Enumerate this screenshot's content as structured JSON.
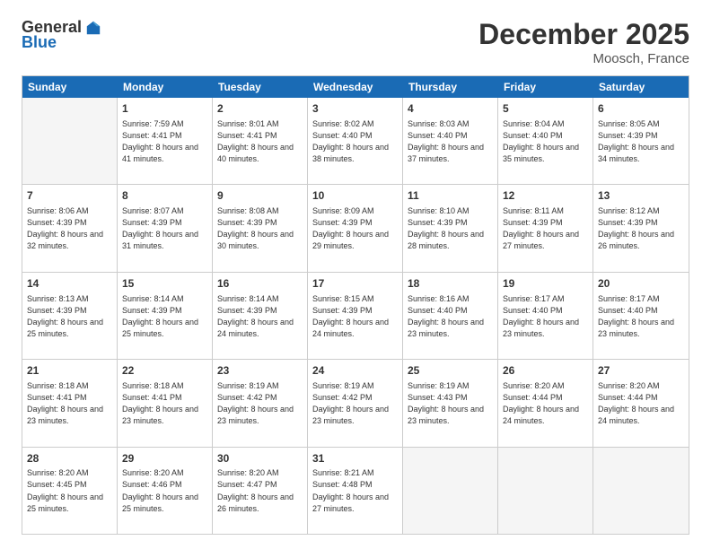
{
  "header": {
    "logo_general": "General",
    "logo_blue": "Blue",
    "month_title": "December 2025",
    "location": "Moosch, France"
  },
  "days_of_week": [
    "Sunday",
    "Monday",
    "Tuesday",
    "Wednesday",
    "Thursday",
    "Friday",
    "Saturday"
  ],
  "weeks": [
    [
      {
        "day": "",
        "empty": true
      },
      {
        "day": "1",
        "sunrise": "Sunrise: 7:59 AM",
        "sunset": "Sunset: 4:41 PM",
        "daylight": "Daylight: 8 hours and 41 minutes."
      },
      {
        "day": "2",
        "sunrise": "Sunrise: 8:01 AM",
        "sunset": "Sunset: 4:41 PM",
        "daylight": "Daylight: 8 hours and 40 minutes."
      },
      {
        "day": "3",
        "sunrise": "Sunrise: 8:02 AM",
        "sunset": "Sunset: 4:40 PM",
        "daylight": "Daylight: 8 hours and 38 minutes."
      },
      {
        "day": "4",
        "sunrise": "Sunrise: 8:03 AM",
        "sunset": "Sunset: 4:40 PM",
        "daylight": "Daylight: 8 hours and 37 minutes."
      },
      {
        "day": "5",
        "sunrise": "Sunrise: 8:04 AM",
        "sunset": "Sunset: 4:40 PM",
        "daylight": "Daylight: 8 hours and 35 minutes."
      },
      {
        "day": "6",
        "sunrise": "Sunrise: 8:05 AM",
        "sunset": "Sunset: 4:39 PM",
        "daylight": "Daylight: 8 hours and 34 minutes."
      }
    ],
    [
      {
        "day": "7",
        "sunrise": "Sunrise: 8:06 AM",
        "sunset": "Sunset: 4:39 PM",
        "daylight": "Daylight: 8 hours and 32 minutes."
      },
      {
        "day": "8",
        "sunrise": "Sunrise: 8:07 AM",
        "sunset": "Sunset: 4:39 PM",
        "daylight": "Daylight: 8 hours and 31 minutes."
      },
      {
        "day": "9",
        "sunrise": "Sunrise: 8:08 AM",
        "sunset": "Sunset: 4:39 PM",
        "daylight": "Daylight: 8 hours and 30 minutes."
      },
      {
        "day": "10",
        "sunrise": "Sunrise: 8:09 AM",
        "sunset": "Sunset: 4:39 PM",
        "daylight": "Daylight: 8 hours and 29 minutes."
      },
      {
        "day": "11",
        "sunrise": "Sunrise: 8:10 AM",
        "sunset": "Sunset: 4:39 PM",
        "daylight": "Daylight: 8 hours and 28 minutes."
      },
      {
        "day": "12",
        "sunrise": "Sunrise: 8:11 AM",
        "sunset": "Sunset: 4:39 PM",
        "daylight": "Daylight: 8 hours and 27 minutes."
      },
      {
        "day": "13",
        "sunrise": "Sunrise: 8:12 AM",
        "sunset": "Sunset: 4:39 PM",
        "daylight": "Daylight: 8 hours and 26 minutes."
      }
    ],
    [
      {
        "day": "14",
        "sunrise": "Sunrise: 8:13 AM",
        "sunset": "Sunset: 4:39 PM",
        "daylight": "Daylight: 8 hours and 25 minutes."
      },
      {
        "day": "15",
        "sunrise": "Sunrise: 8:14 AM",
        "sunset": "Sunset: 4:39 PM",
        "daylight": "Daylight: 8 hours and 25 minutes."
      },
      {
        "day": "16",
        "sunrise": "Sunrise: 8:14 AM",
        "sunset": "Sunset: 4:39 PM",
        "daylight": "Daylight: 8 hours and 24 minutes."
      },
      {
        "day": "17",
        "sunrise": "Sunrise: 8:15 AM",
        "sunset": "Sunset: 4:39 PM",
        "daylight": "Daylight: 8 hours and 24 minutes."
      },
      {
        "day": "18",
        "sunrise": "Sunrise: 8:16 AM",
        "sunset": "Sunset: 4:40 PM",
        "daylight": "Daylight: 8 hours and 23 minutes."
      },
      {
        "day": "19",
        "sunrise": "Sunrise: 8:17 AM",
        "sunset": "Sunset: 4:40 PM",
        "daylight": "Daylight: 8 hours and 23 minutes."
      },
      {
        "day": "20",
        "sunrise": "Sunrise: 8:17 AM",
        "sunset": "Sunset: 4:40 PM",
        "daylight": "Daylight: 8 hours and 23 minutes."
      }
    ],
    [
      {
        "day": "21",
        "sunrise": "Sunrise: 8:18 AM",
        "sunset": "Sunset: 4:41 PM",
        "daylight": "Daylight: 8 hours and 23 minutes."
      },
      {
        "day": "22",
        "sunrise": "Sunrise: 8:18 AM",
        "sunset": "Sunset: 4:41 PM",
        "daylight": "Daylight: 8 hours and 23 minutes."
      },
      {
        "day": "23",
        "sunrise": "Sunrise: 8:19 AM",
        "sunset": "Sunset: 4:42 PM",
        "daylight": "Daylight: 8 hours and 23 minutes."
      },
      {
        "day": "24",
        "sunrise": "Sunrise: 8:19 AM",
        "sunset": "Sunset: 4:42 PM",
        "daylight": "Daylight: 8 hours and 23 minutes."
      },
      {
        "day": "25",
        "sunrise": "Sunrise: 8:19 AM",
        "sunset": "Sunset: 4:43 PM",
        "daylight": "Daylight: 8 hours and 23 minutes."
      },
      {
        "day": "26",
        "sunrise": "Sunrise: 8:20 AM",
        "sunset": "Sunset: 4:44 PM",
        "daylight": "Daylight: 8 hours and 24 minutes."
      },
      {
        "day": "27",
        "sunrise": "Sunrise: 8:20 AM",
        "sunset": "Sunset: 4:44 PM",
        "daylight": "Daylight: 8 hours and 24 minutes."
      }
    ],
    [
      {
        "day": "28",
        "sunrise": "Sunrise: 8:20 AM",
        "sunset": "Sunset: 4:45 PM",
        "daylight": "Daylight: 8 hours and 25 minutes."
      },
      {
        "day": "29",
        "sunrise": "Sunrise: 8:20 AM",
        "sunset": "Sunset: 4:46 PM",
        "daylight": "Daylight: 8 hours and 25 minutes."
      },
      {
        "day": "30",
        "sunrise": "Sunrise: 8:20 AM",
        "sunset": "Sunset: 4:47 PM",
        "daylight": "Daylight: 8 hours and 26 minutes."
      },
      {
        "day": "31",
        "sunrise": "Sunrise: 8:21 AM",
        "sunset": "Sunset: 4:48 PM",
        "daylight": "Daylight: 8 hours and 27 minutes."
      },
      {
        "day": "",
        "empty": true
      },
      {
        "day": "",
        "empty": true
      },
      {
        "day": "",
        "empty": true
      }
    ]
  ]
}
